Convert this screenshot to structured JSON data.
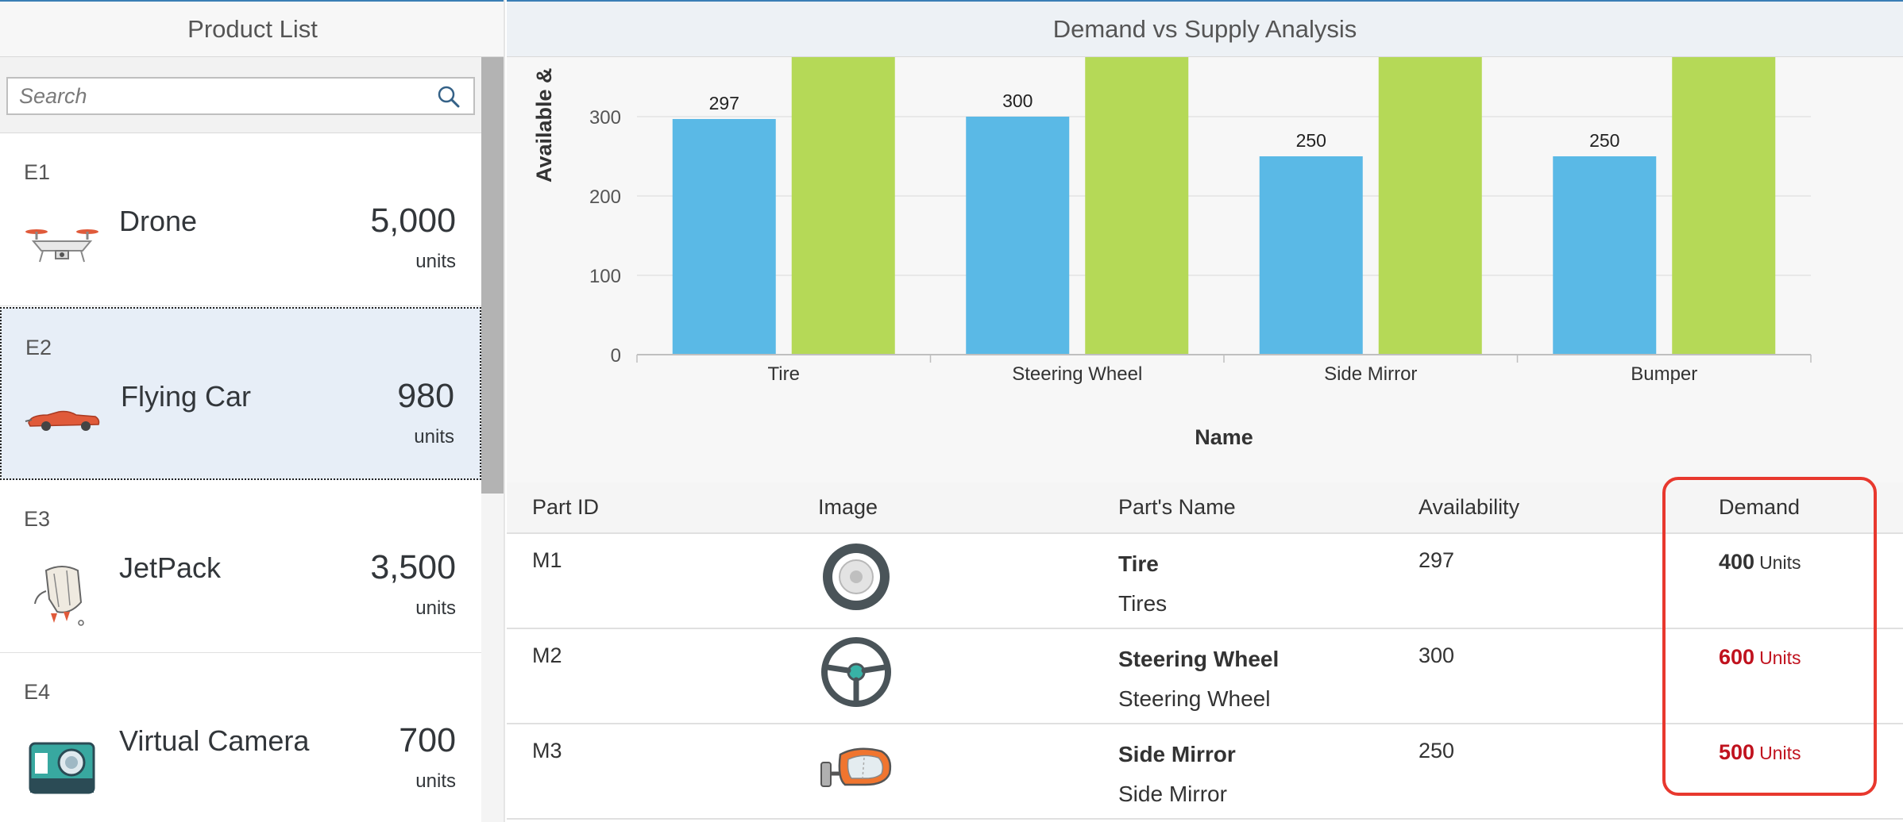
{
  "master": {
    "title": "Product List",
    "search": {
      "placeholder": "Search",
      "value": ""
    },
    "items": [
      {
        "id": "E1",
        "name": "Drone",
        "quantity": "5,000",
        "unit": "units",
        "icon": "drone-icon",
        "selected": false
      },
      {
        "id": "E2",
        "name": "Flying Car",
        "quantity": "980",
        "unit": "units",
        "icon": "flying-car-icon",
        "selected": true
      },
      {
        "id": "E3",
        "name": "JetPack",
        "quantity": "3,500",
        "unit": "units",
        "icon": "jetpack-icon",
        "selected": false
      },
      {
        "id": "E4",
        "name": "Virtual Camera",
        "quantity": "700",
        "unit": "units",
        "icon": "camera-icon",
        "selected": false
      }
    ]
  },
  "detail": {
    "title": "Demand vs Supply Analysis",
    "table": {
      "columns": [
        "Part ID",
        "Image",
        "Part's Name",
        "Availability",
        "Demand"
      ],
      "rows": [
        {
          "id": "M1",
          "icon": "tire-icon",
          "name": "Tire",
          "description": "Tires",
          "availability": "297",
          "demand": "400",
          "demand_unit": "Units",
          "alert": false
        },
        {
          "id": "M2",
          "icon": "steering-wheel-icon",
          "name": "Steering Wheel",
          "description": "Steering Wheel",
          "availability": "300",
          "demand": "600",
          "demand_unit": "Units",
          "alert": true
        },
        {
          "id": "M3",
          "icon": "side-mirror-icon",
          "name": "Side Mirror",
          "description": "Side Mirror",
          "availability": "250",
          "demand": "500",
          "demand_unit": "Units",
          "alert": true
        }
      ]
    }
  },
  "colors": {
    "available_bar": "#5ab9e6",
    "demand_bar": "#b5d957",
    "alert_text": "#c0121e",
    "highlight_border": "#e8382e",
    "selected_row": "#e7eef7"
  },
  "chart_data": {
    "type": "bar",
    "xlabel": "Name",
    "ylabel": "Available &",
    "categories": [
      "Tire",
      "Steering Wheel",
      "Side Mirror",
      "Bumper"
    ],
    "yticks": [
      0,
      100,
      200,
      300
    ],
    "series": [
      {
        "values": [
          297,
          300,
          250,
          250
        ],
        "color": "#5ab9e6",
        "labels_shown": true
      },
      {
        "values": [
          400,
          600,
          500,
          null
        ],
        "color": "#b5d957",
        "labels_shown": false
      }
    ],
    "grid": true
  }
}
